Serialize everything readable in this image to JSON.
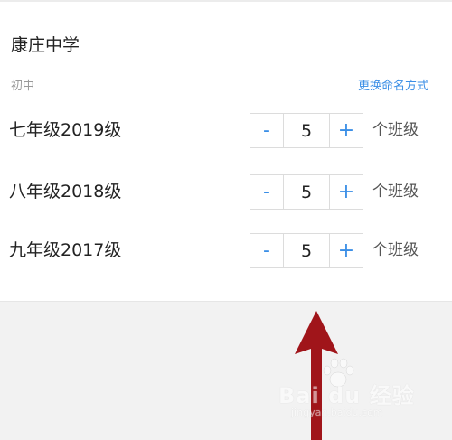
{
  "school": {
    "name": "康庄中学",
    "level": "初中",
    "rename_link": "更换命名方式"
  },
  "grades": [
    {
      "label": "七年级2019级",
      "count": "5",
      "minus": "-",
      "plus": "+",
      "unit": "个班级"
    },
    {
      "label": "八年级2018级",
      "count": "5",
      "minus": "-",
      "plus": "+",
      "unit": "个班级"
    },
    {
      "label": "九年级2017级",
      "count": "5",
      "minus": "-",
      "plus": "+",
      "unit": "个班级"
    }
  ],
  "watermark": {
    "brand": "Bai du 经验",
    "url": "jingyan.baidu.com"
  },
  "colors": {
    "accent": "#3a8ee6",
    "arrow": "#a0151a"
  },
  "icons": {
    "arrow": "arrow-up-icon",
    "paw": "baidu-paw-icon"
  }
}
